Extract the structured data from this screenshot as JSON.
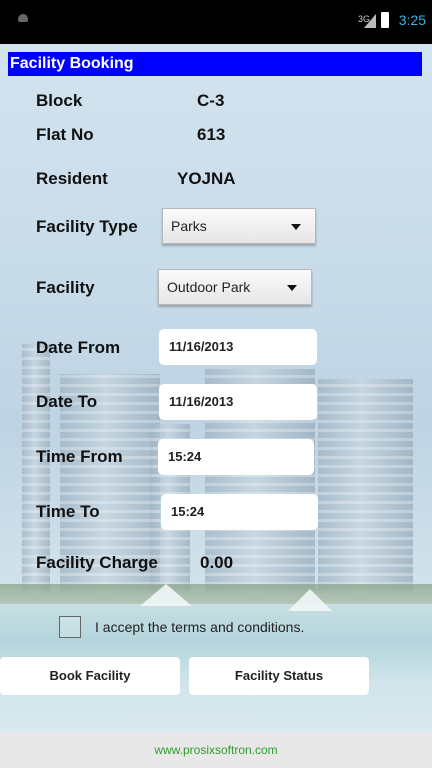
{
  "status_bar": {
    "network": "3G",
    "time": "3:25"
  },
  "screen_title": "Facility Booking",
  "rows": {
    "block": {
      "label": "Block",
      "value": "C-3"
    },
    "flat": {
      "label": "Flat No",
      "value": "613"
    },
    "resident": {
      "label": "Resident",
      "value": "YOJNA"
    },
    "facility_type": {
      "label": "Facility Type",
      "selected": "Parks"
    },
    "facility": {
      "label": "Facility",
      "selected": "Outdoor Park"
    },
    "date_from": {
      "label": "Date From",
      "value": "11/16/2013"
    },
    "date_to": {
      "label": "Date To",
      "value": "11/16/2013"
    },
    "time_from": {
      "label": "Time From",
      "value": "15:24"
    },
    "time_to": {
      "label": "Time To",
      "value": "15:24"
    },
    "charge": {
      "label": "Facility Charge",
      "value": "0.00"
    }
  },
  "terms": {
    "label": "I accept the terms and conditions.",
    "checked": false
  },
  "buttons": {
    "book": "Book Facility",
    "status": "Facility Status"
  },
  "footer": "www.prosixsoftron.com",
  "colors": {
    "title_bar": "#0000ff",
    "footer_text": "#2e9a2e",
    "clock": "#33b5e5"
  }
}
